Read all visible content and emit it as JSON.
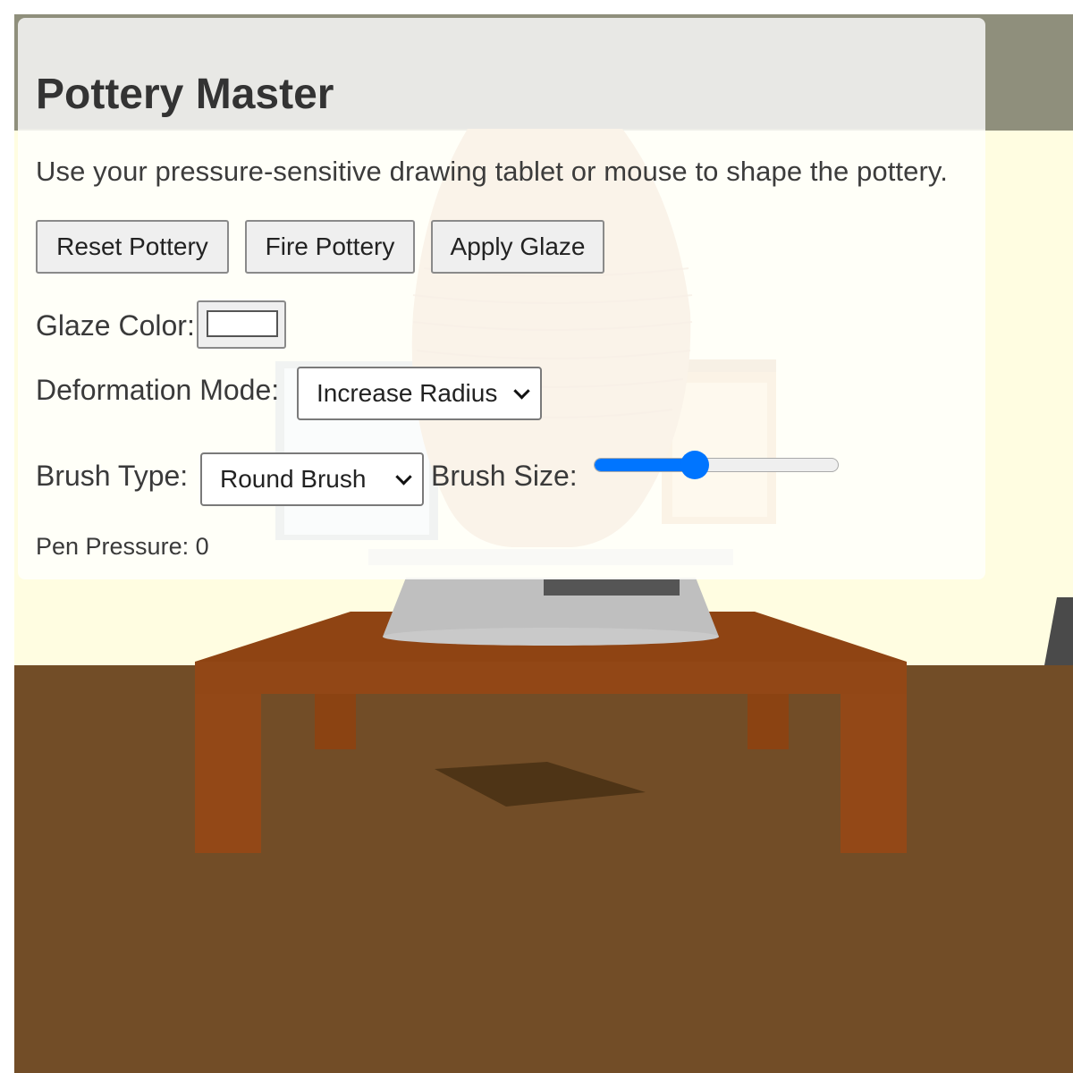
{
  "app": {
    "title": "Pottery Master",
    "instructions": "Use your pressure-sensitive drawing tablet or mouse to shape the pottery."
  },
  "buttons": {
    "reset": "Reset Pottery",
    "fire": "Fire Pottery",
    "glaze": "Apply Glaze"
  },
  "glaze": {
    "label": "Glaze Color:",
    "color": "#ffffff"
  },
  "deformation": {
    "label": "Deformation Mode:",
    "selected": "Increase Radius"
  },
  "brush": {
    "type_label": "Brush Type:",
    "type_selected": "Round Brush",
    "size_label": "Brush Size:",
    "size_fraction": 0.4
  },
  "pressure": {
    "text": "Pen Pressure: 0"
  },
  "colors": {
    "floor": "#724d27",
    "wall": "#fffde1",
    "ceiling": "#8f8f7c",
    "table": "#924716",
    "pottery_clay": "#d8a878",
    "wheel_metal": "#c4c4c4",
    "slider_accent": "#0075ff"
  }
}
